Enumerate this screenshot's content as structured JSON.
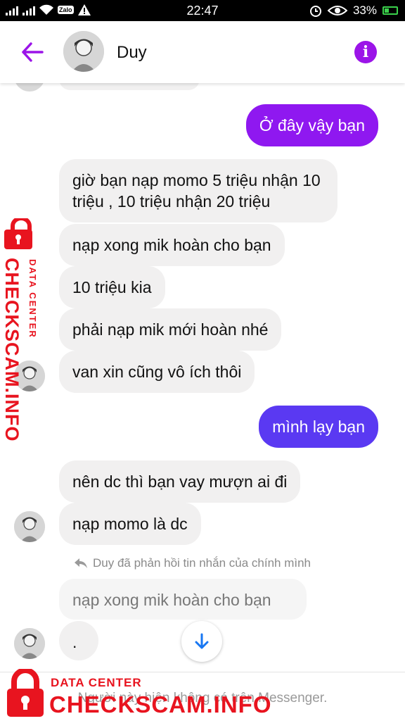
{
  "status_bar": {
    "zalo_label": "Zalo",
    "time": "22:47",
    "battery": "33%"
  },
  "header": {
    "contact_name": "Duy",
    "accent_color": "#9b14e8"
  },
  "messages": [
    {
      "dir": "out",
      "text": "Ở đây vậy bạn"
    },
    {
      "dir": "in",
      "text": "giờ bạn nạp momo 5 triệu nhận 10 triệu , 10 triệu nhận 20 triệu"
    },
    {
      "dir": "in",
      "text": "nạp xong mik hoàn cho bạn"
    },
    {
      "dir": "in",
      "text": "10 triệu kia"
    },
    {
      "dir": "in",
      "text": "phải nạp mik mới hoàn nhé"
    },
    {
      "dir": "in",
      "text": "van xin cũng vô ích thôi"
    },
    {
      "dir": "out",
      "text": "mình lạy bạn"
    },
    {
      "dir": "in",
      "text": "nên dc thì bạn vay mượn ai đi"
    },
    {
      "dir": "in",
      "text": "nạp momo là dc"
    },
    {
      "dir": "in",
      "text": "."
    }
  ],
  "reply": {
    "note": "Duy đã phản hồi tin nhắn của chính mình",
    "quoted_text": "nạp xong mik hoàn cho bạn"
  },
  "footer": {
    "text": "Người này hiện không có trên Messenger."
  },
  "watermark": {
    "small": "DATA CENTER",
    "big": "CHECKSCAM.INFO",
    "color": "#e8141f"
  }
}
